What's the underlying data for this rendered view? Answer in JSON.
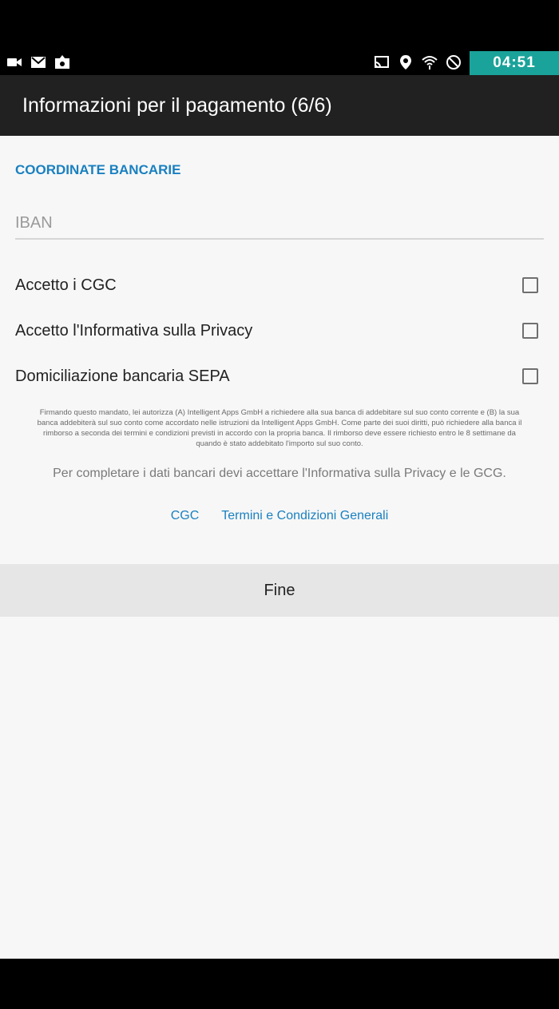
{
  "status_bar": {
    "time": "04:51",
    "left_icons": [
      "video-camera-icon",
      "gmail-icon",
      "image-upload-icon"
    ],
    "right_icons": [
      "cast-icon",
      "location-icon",
      "wifi-icon",
      "do-not-disturb-icon"
    ],
    "accent_color": "#1aa39a"
  },
  "toolbar": {
    "title": "Informazioni per il pagamento (6/6)"
  },
  "form": {
    "section_title": "COORDINATE BANCARIE",
    "iban_placeholder": "IBAN",
    "iban_value": "",
    "checkboxes": [
      {
        "label": "Accetto i CGC",
        "checked": false
      },
      {
        "label": "Accetto l'Informativa sulla Privacy",
        "checked": false
      },
      {
        "label": "Domiciliazione bancaria SEPA",
        "checked": false
      }
    ],
    "mandate_text": "Firmando questo mandato, lei autorizza (A) Intelligent Apps GmbH a richiedere alla sua banca di addebitare sul suo conto corrente e (B) la sua banca addebiterà sul suo conto come accordato nelle istruzioni da Intelligent Apps GmbH. Come parte dei suoi diritti, può richiedere alla banca il rimborso a seconda dei termini e condizioni previsti in accordo con la propria banca. Il rimborso deve essere richiesto entro le 8 settimane da quando è stato addebitato l'importo sul suo conto.",
    "privacy_note": "Per completare i dati bancari devi accettare l'Informativa sulla Privacy e le GCG.",
    "links": [
      "CGC",
      "Termini e Condizioni Generali"
    ],
    "submit_label": "Fine"
  },
  "colors": {
    "link": "#1a80c0",
    "toolbar_bg": "#212121",
    "content_bg": "#f7f7f7"
  }
}
